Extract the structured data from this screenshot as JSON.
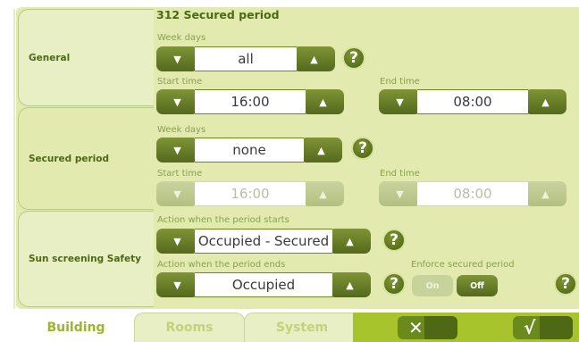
{
  "title": "312 Secured period",
  "sections": {
    "general": "General",
    "secured": "Secured period",
    "sun": "Sun screening Safety"
  },
  "general": {
    "week_days_label": "Week days",
    "week_days_value": "all",
    "start_label": "Start time",
    "start_value": "16:00",
    "end_label": "End time",
    "end_value": "08:00"
  },
  "secured": {
    "week_days_label": "Week days",
    "week_days_value": "none",
    "start_label": "Start time",
    "start_value": "16:00",
    "end_label": "End time",
    "end_value": "08:00"
  },
  "sun": {
    "start_action_label": "Action when the period starts",
    "start_action_value": "Occupied - Secured",
    "end_action_label": "Action when the period ends",
    "end_action_value": "Occupied",
    "enforce_label": "Enforce secured period",
    "on_label": "On",
    "off_label": "Off"
  },
  "help_symbol": "?",
  "icons": {
    "down": "▼",
    "up": "▲",
    "help": "question-icon",
    "cancel": "✕",
    "confirm": "√"
  },
  "tabs": [
    "Building",
    "Rooms",
    "System"
  ],
  "colors": {
    "accent": "#5b7219",
    "panel": "#e2eab0",
    "bar": "#a8c42c"
  }
}
